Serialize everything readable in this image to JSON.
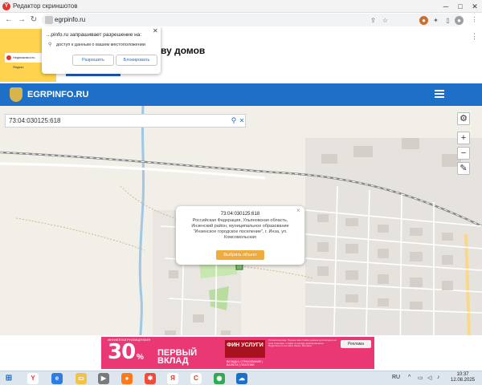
{
  "window": {
    "title": "Редактор скриншотов",
    "app_icon_letter": "Y"
  },
  "browser": {
    "url": "egrpinfo.ru"
  },
  "permission_popup": {
    "title": "...pinfo.ru запрашивает разрешение на:",
    "item": "доступ к данным о вашем местоположении",
    "allow_label": "Разрешить",
    "block_label": "Блокировать"
  },
  "top_ad": {
    "heading": "ву домов",
    "badge_text": "Недвижимость Яндекс"
  },
  "site": {
    "logo_text": "EGRPINFO.RU",
    "brand_color": "#1e6fc8"
  },
  "map": {
    "search_value": "73:04:030125:618",
    "popup": {
      "cadastral_number": "73:04:030125:618",
      "address_lines": [
        "Российская Федерация, Ульяновская область,",
        "Инзенский район, муниципальное образование",
        "\"Инзенское городское поселение\", г. Инза, ул.",
        "Комсомольская"
      ],
      "select_label": "Выбрать объект",
      "close_symbol": "×"
    },
    "controls": {
      "settings_icon": "gear-icon",
      "zoom_in": "+",
      "zoom_out": "−",
      "ruler_icon": "ruler-icon",
      "collapse_symbol": "⌄"
    }
  },
  "bottom_ad": {
    "top_line": "ИНН/КПП/ОГРН/ЛИЦЕНЗИЯ",
    "percent": "30",
    "percent_sign": "%",
    "headline": "ПЕРВЫЙ ВКЛАД",
    "brand": "ФИН УСЛУГИ",
    "sub": "ВКЛАДЫ | СТРАХОВАНИЕ | ВАЛЮТА | ПЛАТЕЖИ",
    "small_print": "Условия вклада. Процентная ставка указана для вкладов на срок 3 месяца. Ставка по вкладу фиксированная. Подробности на сайте банка. Реклама.",
    "ad_label": "Реклама"
  },
  "taskbar": {
    "lang": "RU",
    "time": "10:37",
    "date": "12.08.2025"
  }
}
